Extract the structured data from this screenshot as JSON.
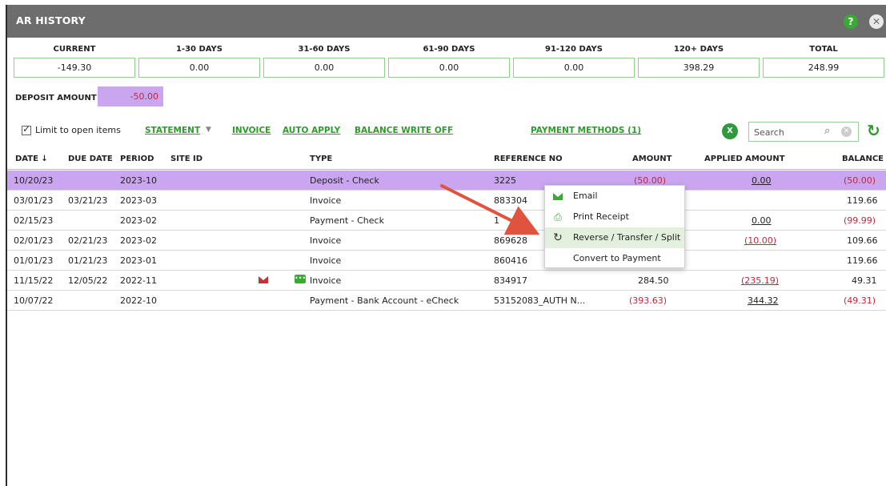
{
  "window": {
    "title": "AR HISTORY",
    "help_label": "?",
    "close_label": "✕"
  },
  "aging": [
    {
      "label": "CURRENT",
      "value": "-149.30"
    },
    {
      "label": "1-30 DAYS",
      "value": "0.00"
    },
    {
      "label": "31-60 DAYS",
      "value": "0.00"
    },
    {
      "label": "61-90 DAYS",
      "value": "0.00"
    },
    {
      "label": "91-120 DAYS",
      "value": "0.00"
    },
    {
      "label": "120+ DAYS",
      "value": "398.29"
    },
    {
      "label": "TOTAL",
      "value": "248.99"
    }
  ],
  "deposit": {
    "label": "DEPOSIT AMOUNT",
    "value": "-50.00"
  },
  "toolbar": {
    "limit_label": "Limit to open items",
    "limit_checked": true,
    "statement": "STATEMENT",
    "invoice": "INVOICE",
    "auto_apply": "AUTO APPLY",
    "balance_write_off": "BALANCE WRITE OFF",
    "payment_methods": "PAYMENT METHODS (1)",
    "search_placeholder": "Search",
    "excel_icon": "excel-icon",
    "refresh_icon": "refresh-icon"
  },
  "columns": {
    "date": "DATE",
    "due_date": "DUE DATE",
    "period": "PERIOD",
    "site_id": "SITE ID",
    "type": "TYPE",
    "reference_no": "REFERENCE NO",
    "amount": "AMOUNT",
    "applied_amount": "APPLIED AMOUNT",
    "balance": "BALANCE"
  },
  "rows": [
    {
      "date": "10/20/23",
      "due": "",
      "period": "2023-10",
      "type": "Deposit - Check",
      "ref": "3225",
      "amount": "(50.00)",
      "applied": "0.00",
      "balance": "(50.00)"
    },
    {
      "date": "03/01/23",
      "due": "03/21/23",
      "period": "2023-03",
      "type": "Invoice",
      "ref": "883304",
      "amount": "",
      "applied": "",
      "balance": "119.66"
    },
    {
      "date": "02/15/23",
      "due": "",
      "period": "2023-02",
      "type": "Payment - Check",
      "ref": "1",
      "amount": "",
      "applied": "0.00",
      "balance": "(99.99)"
    },
    {
      "date": "02/01/23",
      "due": "02/21/23",
      "period": "2023-02",
      "type": "Invoice",
      "ref": "869628",
      "amount": "",
      "applied": "(10.00)",
      "balance": "109.66"
    },
    {
      "date": "01/01/23",
      "due": "01/21/23",
      "period": "2023-01",
      "type": "Invoice",
      "ref": "860416",
      "amount": "",
      "applied": "",
      "balance": "119.66"
    },
    {
      "date": "11/15/22",
      "due": "12/05/22",
      "period": "2022-11",
      "type": "Invoice",
      "ref": "834917",
      "amount": "284.50",
      "applied": "(235.19)",
      "balance": "49.31"
    },
    {
      "date": "10/07/22",
      "due": "",
      "period": "2022-10",
      "type": "Payment - Bank Account - eCheck",
      "ref": "53152083_AUTH N...",
      "amount": "(393.63)",
      "applied": "344.32",
      "balance": "(49.31)"
    }
  ],
  "context_menu": [
    {
      "label": "Email",
      "icon": "envelope-icon"
    },
    {
      "label": "Print Receipt",
      "icon": "printer-icon"
    },
    {
      "label": "Reverse / Transfer / Split",
      "icon": "reverse-icon"
    },
    {
      "label": "Convert to Payment",
      "icon": ""
    }
  ],
  "colors": {
    "accent_green": "#2e9b2e",
    "selected_row": "#c9a6ef",
    "negative": "#c0283b",
    "titlebar": "#6d6d6d"
  }
}
